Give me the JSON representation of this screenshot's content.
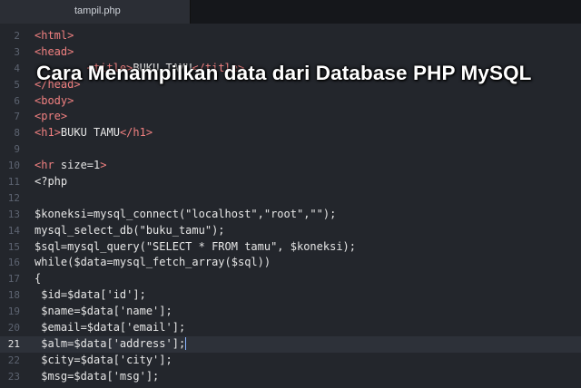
{
  "tab": {
    "label": "tampil.php"
  },
  "overlay_title": "Cara Menampilkan data dari Database PHP MySQL",
  "colors": {
    "background": "#23262c",
    "tag": "#f08080",
    "text": "#e6e6e6",
    "line_number": "#5c6370"
  },
  "lines": [
    {
      "num": "2",
      "text": "<html>"
    },
    {
      "num": "3",
      "text": "<head>"
    },
    {
      "num": "4",
      "text": "        <title>BUKU TAMU</title>"
    },
    {
      "num": "5",
      "text": "</head>"
    },
    {
      "num": "6",
      "text": "<body>"
    },
    {
      "num": "7",
      "text": "<pre>"
    },
    {
      "num": "8",
      "text": "<h1>BUKU TAMU</h1>"
    },
    {
      "num": "9",
      "text": ""
    },
    {
      "num": "10",
      "text": "<hr size=1>"
    },
    {
      "num": "11",
      "text": "<?php"
    },
    {
      "num": "12",
      "text": ""
    },
    {
      "num": "13",
      "text": "$koneksi=mysql_connect(\"localhost\",\"root\",\"\");"
    },
    {
      "num": "14",
      "text": "mysql_select_db(\"buku_tamu\");"
    },
    {
      "num": "15",
      "text": "$sql=mysql_query(\"SELECT * FROM tamu\", $koneksi);"
    },
    {
      "num": "16",
      "text": "while($data=mysql_fetch_array($sql))"
    },
    {
      "num": "17",
      "text": "{"
    },
    {
      "num": "18",
      "text": " $id=$data['id'];"
    },
    {
      "num": "19",
      "text": " $name=$data['name'];"
    },
    {
      "num": "20",
      "text": " $email=$data['email'];"
    },
    {
      "num": "21",
      "text": " $alm=$data['address'];"
    },
    {
      "num": "22",
      "text": " $city=$data['city'];"
    },
    {
      "num": "23",
      "text": " $msg=$data['msg'];"
    }
  ],
  "current_line": "21"
}
